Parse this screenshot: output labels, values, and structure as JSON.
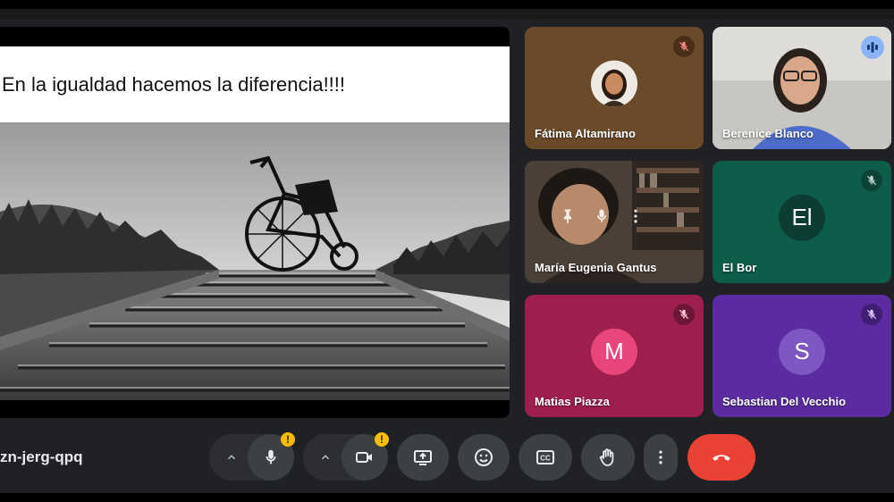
{
  "meeting": {
    "code": "zn-jerg-qpq"
  },
  "presentation": {
    "slide_title": "En la igualdad hacemos la diferencia!!!!",
    "image_icon": "wheelchair-on-stairs-photo"
  },
  "participants": [
    {
      "name": "Fátima Altamirano",
      "type": "photo-avatar",
      "muted": true,
      "bg": "#6b4a2a"
    },
    {
      "name": "Berenice Blanco",
      "type": "video",
      "muted": false,
      "speaking": true,
      "bg": "#b9b7b4"
    },
    {
      "name": "María Eugenia Gantus",
      "type": "video",
      "muted": false,
      "bg": "#3a3530"
    },
    {
      "name": "El Bor",
      "type": "initials",
      "initials": "El",
      "muted": true,
      "bg": "#0e5c4a",
      "avatar_bg": "#0b3d32"
    },
    {
      "name": "Matias Piazza",
      "type": "initials",
      "initials": "M",
      "muted": true,
      "bg": "#9c1f4e",
      "avatar_bg": "#e8457a"
    },
    {
      "name": "Sebastian Del Vecchio",
      "type": "initials",
      "initials": "S",
      "muted": true,
      "bg": "#5b2ca0",
      "avatar_bg": "#7e57c2"
    }
  ],
  "controls": {
    "mic": {
      "icon": "mic-icon",
      "warning": "!"
    },
    "camera": {
      "icon": "camera-icon",
      "warning": "!"
    },
    "present": {
      "icon": "present-screen-icon"
    },
    "reactions": {
      "icon": "emoji-icon"
    },
    "captions": {
      "icon": "closed-captions-icon",
      "label": "CC"
    },
    "raise_hand": {
      "icon": "hand-icon"
    },
    "more": {
      "icon": "more-vert-icon"
    },
    "end_call": {
      "icon": "phone-hangup-icon"
    }
  },
  "colors": {
    "end_call": "#ea4335",
    "warning": "#fbbc04",
    "speaking_ring": "#8ab4f8",
    "control_bg": "#3c4043"
  }
}
